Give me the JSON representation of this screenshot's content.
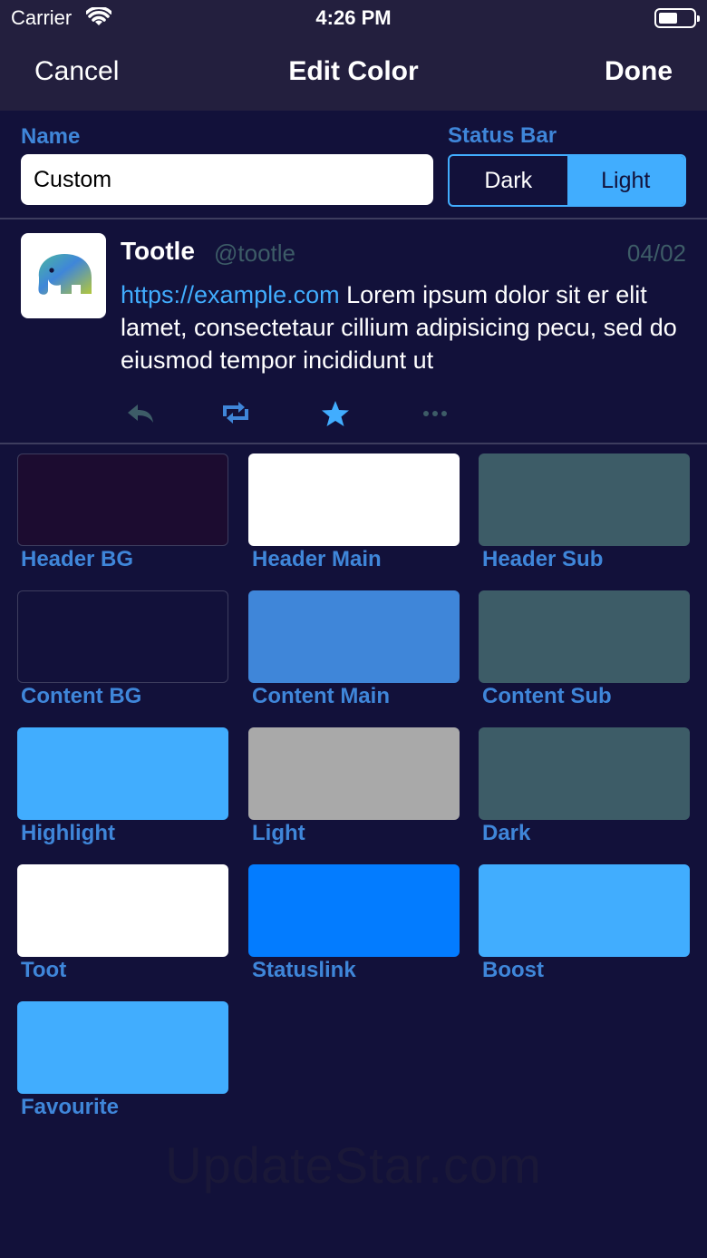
{
  "status_bar": {
    "carrier": "Carrier",
    "time": "4:26 PM"
  },
  "nav": {
    "cancel": "Cancel",
    "title": "Edit Color",
    "done": "Done"
  },
  "form": {
    "name_label": "Name",
    "name_value": "Custom",
    "status_bar_label": "Status Bar",
    "segment_dark": "Dark",
    "segment_light": "Light",
    "selected_segment": "Light"
  },
  "preview": {
    "display_name": "Tootle",
    "handle": "@tootle",
    "date": "04/02",
    "link": "https://example.com",
    "text": " Lorem ipsum dolor sit er elit lamet, consectetaur cillium adipisicing pecu, sed do eiusmod tempor incididunt ut",
    "actions": [
      "reply-icon",
      "boost-icon",
      "favourite-icon",
      "more-icon"
    ]
  },
  "swatches": [
    {
      "label": "Header BG",
      "color": "#1c0c30"
    },
    {
      "label": "Header Main",
      "color": "#ffffff"
    },
    {
      "label": "Header Sub",
      "color": "#3d5c67"
    },
    {
      "label": "Content BG",
      "color": "#12113a"
    },
    {
      "label": "Content Main",
      "color": "#3f86d9"
    },
    {
      "label": "Content Sub",
      "color": "#3d5c67"
    },
    {
      "label": "Highlight",
      "color": "#41adfe"
    },
    {
      "label": "Light",
      "color": "#a9a9a9"
    },
    {
      "label": "Dark",
      "color": "#3d5c67"
    },
    {
      "label": "Toot",
      "color": "#ffffff"
    },
    {
      "label": "Statuslink",
      "color": "#037cff"
    },
    {
      "label": "Boost",
      "color": "#41adfe"
    },
    {
      "label": "Favourite",
      "color": "#41adfe"
    }
  ],
  "watermark": "UpdateStar.com",
  "colors": {
    "background": "#12113a",
    "header_bg": "#231f3e",
    "accent": "#41adfe",
    "label_blue": "#3f86d9",
    "sub_text": "#3d5c67"
  }
}
